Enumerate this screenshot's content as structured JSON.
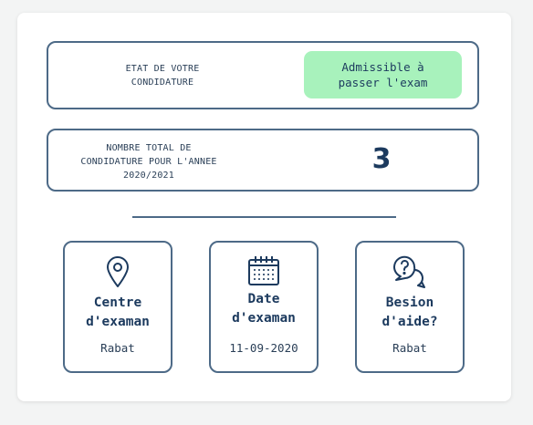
{
  "status": {
    "label": "ETAT DE VOTRE\nCONDIDATURE",
    "value": "Admissible à\npasser l'exam",
    "value_color": "#a8f2bc"
  },
  "total": {
    "label": "NOMBRE TOTAL DE\nCONDIDATURE POUR L'ANNEE\n2020/2021",
    "value": "3"
  },
  "tiles": [
    {
      "icon": "location-pin-icon",
      "title": "Centre\nd'examan",
      "value": "Rabat"
    },
    {
      "icon": "calendar-icon",
      "title": "Date\nd'examan",
      "value": "11-09-2020"
    },
    {
      "icon": "help-chat-icon",
      "title": "Besion\nd'aide?",
      "value": "Rabat"
    }
  ],
  "colors": {
    "primary": "#1c3a5e",
    "border": "#4d6a87",
    "success_bg": "#a8f2bc"
  }
}
